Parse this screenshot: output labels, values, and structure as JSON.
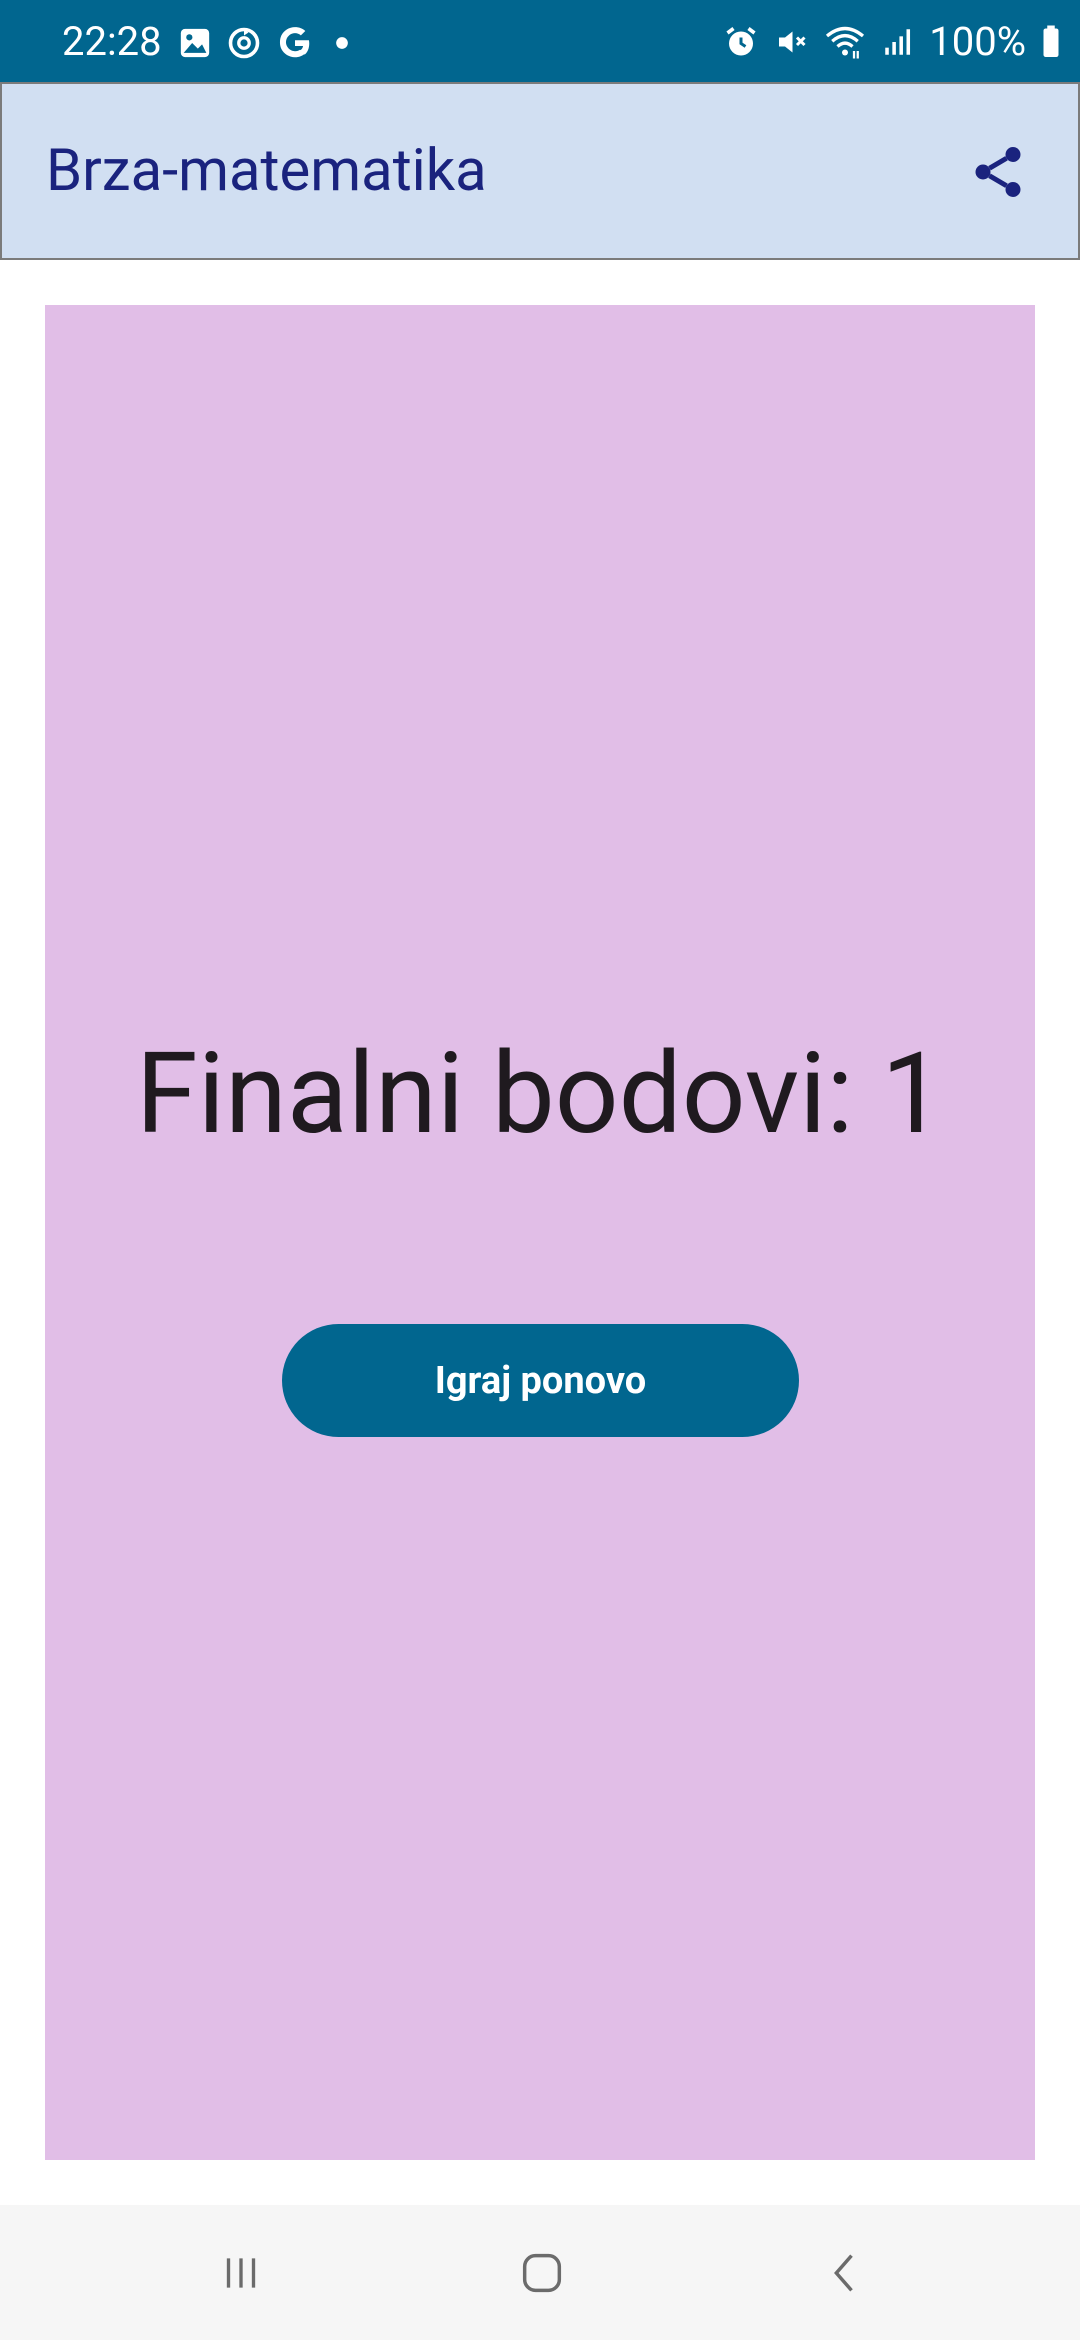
{
  "status_bar": {
    "time": "22:28",
    "left_icons": [
      "gallery-icon",
      "sync-icon",
      "google-icon",
      "notification-dot-icon"
    ],
    "right_icons": [
      "alarm-icon",
      "mute-icon",
      "wifi-icon",
      "signal-icon"
    ],
    "battery": "100%",
    "background": "#01668F"
  },
  "app_bar": {
    "title": "Brza-matematika",
    "action_icon": "share-icon",
    "background": "#D1DFF2",
    "title_color": "#1A237E"
  },
  "main": {
    "panel_color": "#E1BEE7",
    "score_text": "Finalni bodovi: 1",
    "play_again_label": "Igraj ponovo",
    "button_color": "#01668F"
  },
  "nav_bar": {
    "buttons": [
      "recent-apps-icon",
      "home-icon",
      "back-icon"
    ]
  }
}
